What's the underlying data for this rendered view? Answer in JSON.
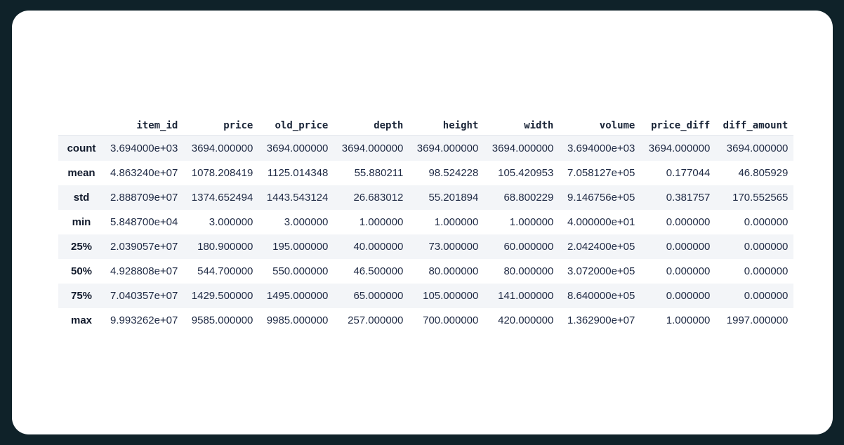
{
  "table": {
    "columns": [
      "item_id",
      "price",
      "old_price",
      "depth",
      "height",
      "width",
      "volume",
      "price_diff",
      "diff_amount"
    ],
    "rows": [
      {
        "label": "count",
        "values": [
          "3.694000e+03",
          "3694.000000",
          "3694.000000",
          "3694.000000",
          "3694.000000",
          "3694.000000",
          "3.694000e+03",
          "3694.000000",
          "3694.000000"
        ]
      },
      {
        "label": "mean",
        "values": [
          "4.863240e+07",
          "1078.208419",
          "1125.014348",
          "55.880211",
          "98.524228",
          "105.420953",
          "7.058127e+05",
          "0.177044",
          "46.805929"
        ]
      },
      {
        "label": "std",
        "values": [
          "2.888709e+07",
          "1374.652494",
          "1443.543124",
          "26.683012",
          "55.201894",
          "68.800229",
          "9.146756e+05",
          "0.381757",
          "170.552565"
        ]
      },
      {
        "label": "min",
        "values": [
          "5.848700e+04",
          "3.000000",
          "3.000000",
          "1.000000",
          "1.000000",
          "1.000000",
          "4.000000e+01",
          "0.000000",
          "0.000000"
        ]
      },
      {
        "label": "25%",
        "values": [
          "2.039057e+07",
          "180.900000",
          "195.000000",
          "40.000000",
          "73.000000",
          "60.000000",
          "2.042400e+05",
          "0.000000",
          "0.000000"
        ]
      },
      {
        "label": "50%",
        "values": [
          "4.928808e+07",
          "544.700000",
          "550.000000",
          "46.500000",
          "80.000000",
          "80.000000",
          "3.072000e+05",
          "0.000000",
          "0.000000"
        ]
      },
      {
        "label": "75%",
        "values": [
          "7.040357e+07",
          "1429.500000",
          "1495.000000",
          "65.000000",
          "105.000000",
          "141.000000",
          "8.640000e+05",
          "0.000000",
          "0.000000"
        ]
      },
      {
        "label": "max",
        "values": [
          "9.993262e+07",
          "9585.000000",
          "9985.000000",
          "257.000000",
          "700.000000",
          "420.000000",
          "1.362900e+07",
          "1.000000",
          "1997.000000"
        ]
      }
    ]
  }
}
